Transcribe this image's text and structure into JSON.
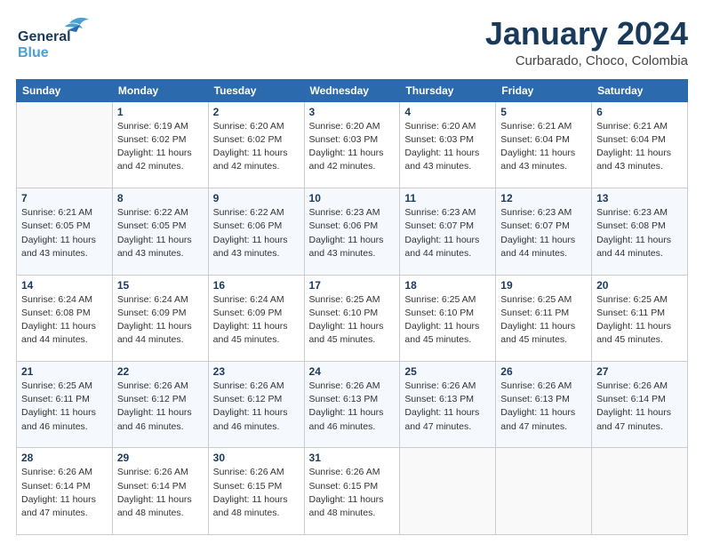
{
  "logo": {
    "line1": "General",
    "line2": "Blue",
    "bird": "🐦"
  },
  "header": {
    "month": "January 2024",
    "location": "Curbarado, Choco, Colombia"
  },
  "weekdays": [
    "Sunday",
    "Monday",
    "Tuesday",
    "Wednesday",
    "Thursday",
    "Friday",
    "Saturday"
  ],
  "weeks": [
    [
      {
        "day": "",
        "info": ""
      },
      {
        "day": "1",
        "info": "Sunrise: 6:19 AM\nSunset: 6:02 PM\nDaylight: 11 hours\nand 42 minutes."
      },
      {
        "day": "2",
        "info": "Sunrise: 6:20 AM\nSunset: 6:02 PM\nDaylight: 11 hours\nand 42 minutes."
      },
      {
        "day": "3",
        "info": "Sunrise: 6:20 AM\nSunset: 6:03 PM\nDaylight: 11 hours\nand 42 minutes."
      },
      {
        "day": "4",
        "info": "Sunrise: 6:20 AM\nSunset: 6:03 PM\nDaylight: 11 hours\nand 43 minutes."
      },
      {
        "day": "5",
        "info": "Sunrise: 6:21 AM\nSunset: 6:04 PM\nDaylight: 11 hours\nand 43 minutes."
      },
      {
        "day": "6",
        "info": "Sunrise: 6:21 AM\nSunset: 6:04 PM\nDaylight: 11 hours\nand 43 minutes."
      }
    ],
    [
      {
        "day": "7",
        "info": "Sunrise: 6:21 AM\nSunset: 6:05 PM\nDaylight: 11 hours\nand 43 minutes."
      },
      {
        "day": "8",
        "info": "Sunrise: 6:22 AM\nSunset: 6:05 PM\nDaylight: 11 hours\nand 43 minutes."
      },
      {
        "day": "9",
        "info": "Sunrise: 6:22 AM\nSunset: 6:06 PM\nDaylight: 11 hours\nand 43 minutes."
      },
      {
        "day": "10",
        "info": "Sunrise: 6:23 AM\nSunset: 6:06 PM\nDaylight: 11 hours\nand 43 minutes."
      },
      {
        "day": "11",
        "info": "Sunrise: 6:23 AM\nSunset: 6:07 PM\nDaylight: 11 hours\nand 44 minutes."
      },
      {
        "day": "12",
        "info": "Sunrise: 6:23 AM\nSunset: 6:07 PM\nDaylight: 11 hours\nand 44 minutes."
      },
      {
        "day": "13",
        "info": "Sunrise: 6:23 AM\nSunset: 6:08 PM\nDaylight: 11 hours\nand 44 minutes."
      }
    ],
    [
      {
        "day": "14",
        "info": "Sunrise: 6:24 AM\nSunset: 6:08 PM\nDaylight: 11 hours\nand 44 minutes."
      },
      {
        "day": "15",
        "info": "Sunrise: 6:24 AM\nSunset: 6:09 PM\nDaylight: 11 hours\nand 44 minutes."
      },
      {
        "day": "16",
        "info": "Sunrise: 6:24 AM\nSunset: 6:09 PM\nDaylight: 11 hours\nand 45 minutes."
      },
      {
        "day": "17",
        "info": "Sunrise: 6:25 AM\nSunset: 6:10 PM\nDaylight: 11 hours\nand 45 minutes."
      },
      {
        "day": "18",
        "info": "Sunrise: 6:25 AM\nSunset: 6:10 PM\nDaylight: 11 hours\nand 45 minutes."
      },
      {
        "day": "19",
        "info": "Sunrise: 6:25 AM\nSunset: 6:11 PM\nDaylight: 11 hours\nand 45 minutes."
      },
      {
        "day": "20",
        "info": "Sunrise: 6:25 AM\nSunset: 6:11 PM\nDaylight: 11 hours\nand 45 minutes."
      }
    ],
    [
      {
        "day": "21",
        "info": "Sunrise: 6:25 AM\nSunset: 6:11 PM\nDaylight: 11 hours\nand 46 minutes."
      },
      {
        "day": "22",
        "info": "Sunrise: 6:26 AM\nSunset: 6:12 PM\nDaylight: 11 hours\nand 46 minutes."
      },
      {
        "day": "23",
        "info": "Sunrise: 6:26 AM\nSunset: 6:12 PM\nDaylight: 11 hours\nand 46 minutes."
      },
      {
        "day": "24",
        "info": "Sunrise: 6:26 AM\nSunset: 6:13 PM\nDaylight: 11 hours\nand 46 minutes."
      },
      {
        "day": "25",
        "info": "Sunrise: 6:26 AM\nSunset: 6:13 PM\nDaylight: 11 hours\nand 47 minutes."
      },
      {
        "day": "26",
        "info": "Sunrise: 6:26 AM\nSunset: 6:13 PM\nDaylight: 11 hours\nand 47 minutes."
      },
      {
        "day": "27",
        "info": "Sunrise: 6:26 AM\nSunset: 6:14 PM\nDaylight: 11 hours\nand 47 minutes."
      }
    ],
    [
      {
        "day": "28",
        "info": "Sunrise: 6:26 AM\nSunset: 6:14 PM\nDaylight: 11 hours\nand 47 minutes."
      },
      {
        "day": "29",
        "info": "Sunrise: 6:26 AM\nSunset: 6:14 PM\nDaylight: 11 hours\nand 48 minutes."
      },
      {
        "day": "30",
        "info": "Sunrise: 6:26 AM\nSunset: 6:15 PM\nDaylight: 11 hours\nand 48 minutes."
      },
      {
        "day": "31",
        "info": "Sunrise: 6:26 AM\nSunset: 6:15 PM\nDaylight: 11 hours\nand 48 minutes."
      },
      {
        "day": "",
        "info": ""
      },
      {
        "day": "",
        "info": ""
      },
      {
        "day": "",
        "info": ""
      }
    ]
  ]
}
